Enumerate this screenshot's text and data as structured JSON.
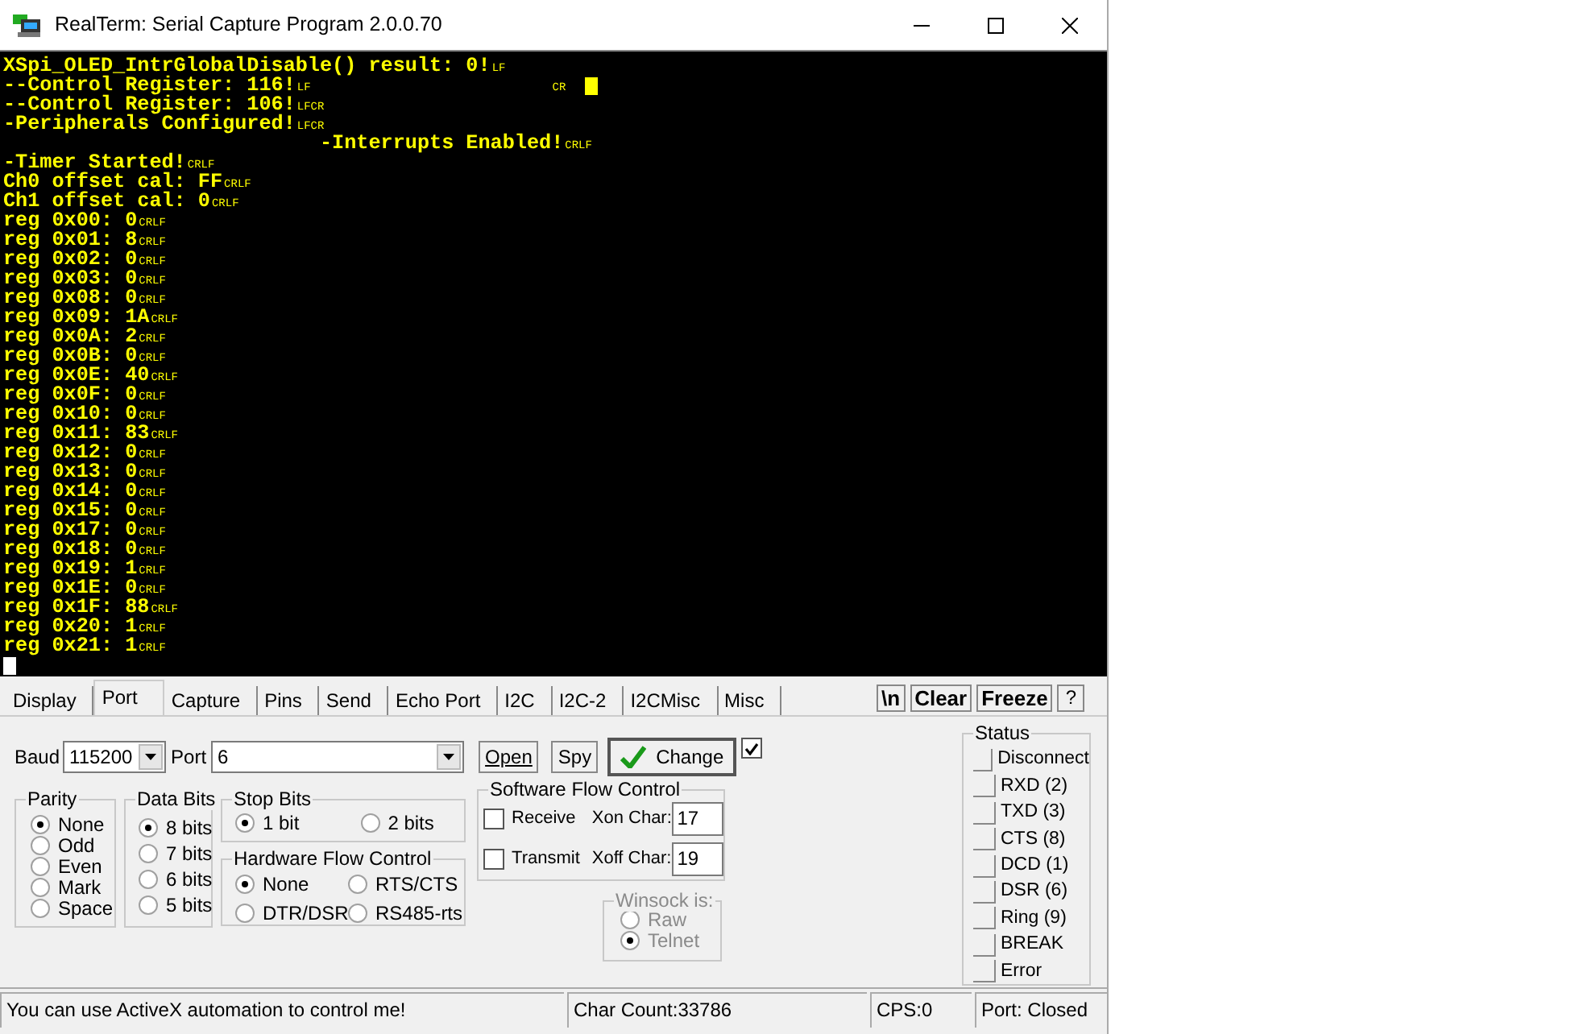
{
  "window": {
    "title": "RealTerm: Serial Capture Program 2.0.0.70"
  },
  "terminal": {
    "cursor_visible": true,
    "lines": [
      {
        "text": "XSpi_OLED_IntrGlobalDisable() result: 0!",
        "end": "LF"
      },
      {
        "text": "--Control Register: 116!",
        "end": "LF",
        "far_end": "CR",
        "far_cursor": true
      },
      {
        "text": "--Control Register: 106!",
        "end": "LFCR"
      },
      {
        "text": "-Peripherals Configured!",
        "end": "LFCR"
      },
      {
        "text": "                          -Interrupts Enabled!",
        "end": "CRLF"
      },
      {
        "text": "-Timer Started!",
        "end": "CRLF"
      },
      {
        "text": "Ch0 offset cal: FF",
        "end": "CRLF"
      },
      {
        "text": "Ch1 offset cal: 0",
        "end": "CRLF"
      },
      {
        "text": "reg 0x00: 0",
        "end": "CRLF"
      },
      {
        "text": "reg 0x01: 8",
        "end": "CRLF"
      },
      {
        "text": "reg 0x02: 0",
        "end": "CRLF"
      },
      {
        "text": "reg 0x03: 0",
        "end": "CRLF"
      },
      {
        "text": "reg 0x08: 0",
        "end": "CRLF"
      },
      {
        "text": "reg 0x09: 1A",
        "end": "CRLF"
      },
      {
        "text": "reg 0x0A: 2",
        "end": "CRLF"
      },
      {
        "text": "reg 0x0B: 0",
        "end": "CRLF"
      },
      {
        "text": "reg 0x0E: 40",
        "end": "CRLF"
      },
      {
        "text": "reg 0x0F: 0",
        "end": "CRLF"
      },
      {
        "text": "reg 0x10: 0",
        "end": "CRLF"
      },
      {
        "text": "reg 0x11: 83",
        "end": "CRLF"
      },
      {
        "text": "reg 0x12: 0",
        "end": "CRLF"
      },
      {
        "text": "reg 0x13: 0",
        "end": "CRLF"
      },
      {
        "text": "reg 0x14: 0",
        "end": "CRLF"
      },
      {
        "text": "reg 0x15: 0",
        "end": "CRLF"
      },
      {
        "text": "reg 0x17: 0",
        "end": "CRLF"
      },
      {
        "text": "reg 0x18: 0",
        "end": "CRLF"
      },
      {
        "text": "reg 0x19: 1",
        "end": "CRLF"
      },
      {
        "text": "reg 0x1E: 0",
        "end": "CRLF"
      },
      {
        "text": "reg 0x1F: 88",
        "end": "CRLF"
      },
      {
        "text": "reg 0x20: 1",
        "end": "CRLF"
      },
      {
        "text": "reg 0x21: 1",
        "end": "CRLF"
      }
    ]
  },
  "tabs": [
    {
      "label": "Display",
      "selected": false
    },
    {
      "label": "Port",
      "selected": true
    },
    {
      "label": "Capture",
      "selected": false
    },
    {
      "label": "Pins",
      "selected": false
    },
    {
      "label": "Send",
      "selected": false
    },
    {
      "label": "Echo Port",
      "selected": false
    },
    {
      "label": "I2C",
      "selected": false
    },
    {
      "label": "I2C-2",
      "selected": false
    },
    {
      "label": "I2CMisc",
      "selected": false
    },
    {
      "label": "Misc",
      "selected": false
    }
  ],
  "toolbar_buttons": [
    "\\n",
    "Clear",
    "Freeze",
    "?"
  ],
  "port": {
    "baud_label": "Baud",
    "baud": "115200",
    "port_label": "Port",
    "port": "6",
    "open": "Open",
    "spy": "Spy",
    "change": "Change",
    "change_checked": true
  },
  "parity": {
    "title": "Parity",
    "options": [
      {
        "label": "None",
        "selected": true
      },
      {
        "label": "Odd",
        "selected": false
      },
      {
        "label": "Even",
        "selected": false
      },
      {
        "label": "Mark",
        "selected": false
      },
      {
        "label": "Space",
        "selected": false
      }
    ]
  },
  "data_bits": {
    "title": "Data Bits",
    "options": [
      {
        "label": "8 bits",
        "selected": true
      },
      {
        "label": "7 bits",
        "selected": false
      },
      {
        "label": "6 bits",
        "selected": false
      },
      {
        "label": "5 bits",
        "selected": false
      }
    ]
  },
  "stop_bits": {
    "title": "Stop Bits",
    "options": [
      {
        "label": "1 bit",
        "selected": true
      },
      {
        "label": "2 bits",
        "selected": false
      }
    ]
  },
  "hardware_flow": {
    "title": "Hardware Flow Control",
    "options": [
      {
        "label": "None",
        "selected": true
      },
      {
        "label": "RTS/CTS",
        "selected": false
      },
      {
        "label": "DTR/DSR",
        "selected": false
      },
      {
        "label": "RS485-rts",
        "selected": false
      }
    ]
  },
  "software_flow": {
    "title": "Software Flow Control",
    "rows": [
      {
        "label": "Receive",
        "checked": false,
        "char_label": "Xon Char:",
        "char": "17"
      },
      {
        "label": "Transmit",
        "checked": false,
        "char_label": "Xoff Char:",
        "char": "19"
      }
    ]
  },
  "winsock": {
    "title": "Winsock is:",
    "options": [
      {
        "label": "Raw",
        "selected": false
      },
      {
        "label": "Telnet",
        "selected": true
      }
    ]
  },
  "status": {
    "title": "Status",
    "items": [
      {
        "label": "Disconnect",
        "on": false
      },
      {
        "label": "RXD (2)",
        "on": false
      },
      {
        "label": "TXD (3)",
        "on": false
      },
      {
        "label": "CTS (8)",
        "on": false
      },
      {
        "label": "DCD (1)",
        "on": false
      },
      {
        "label": "DSR (6)",
        "on": false
      },
      {
        "label": "Ring (9)",
        "on": false
      },
      {
        "label": "BREAK",
        "on": false
      },
      {
        "label": "Error",
        "on": false
      }
    ]
  },
  "status_bar": [
    "You can use ActiveX automation to control me!",
    "Char Count:33786",
    "CPS:0",
    "Port: Closed"
  ]
}
